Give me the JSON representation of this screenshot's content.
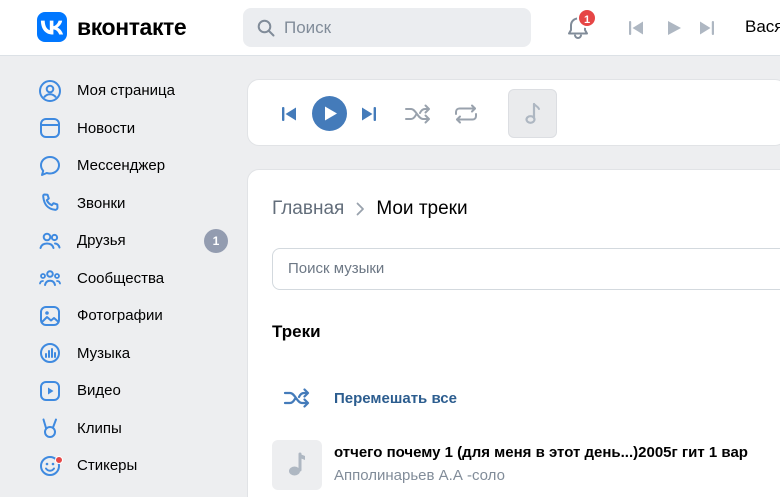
{
  "header": {
    "logo_text": "вконтакте",
    "search_placeholder": "Поиск",
    "notification_count": "1",
    "user_name_partial": "Вася"
  },
  "sidebar": {
    "items": [
      {
        "label": "Моя страница",
        "icon": "user-circle-icon"
      },
      {
        "label": "Новости",
        "icon": "news-icon"
      },
      {
        "label": "Мессенджер",
        "icon": "message-icon"
      },
      {
        "label": "Звонки",
        "icon": "phone-icon"
      },
      {
        "label": "Друзья",
        "icon": "friends-icon",
        "badge": "1"
      },
      {
        "label": "Сообщества",
        "icon": "communities-icon"
      },
      {
        "label": "Фотографии",
        "icon": "photo-icon"
      },
      {
        "label": "Музыка",
        "icon": "music-icon"
      },
      {
        "label": "Видео",
        "icon": "video-icon"
      },
      {
        "label": "Клипы",
        "icon": "clips-icon"
      },
      {
        "label": "Стикеры",
        "icon": "stickers-icon"
      }
    ]
  },
  "main": {
    "breadcrumb_home": "Главная",
    "breadcrumb_current": "Мои треки",
    "music_search_placeholder": "Поиск музыки",
    "section_title": "Треки",
    "shuffle_label": "Перемешать все",
    "tracks": [
      {
        "title": "отчего почему 1 (для меня в этот день...)2005г гит 1 вар",
        "artist": "Апполинарьев А.А -соло"
      }
    ]
  },
  "colors": {
    "accent": "#447bba",
    "brand": "#0077ff",
    "badge_red": "#e64646",
    "icon_blue": "#3f8ae0"
  }
}
